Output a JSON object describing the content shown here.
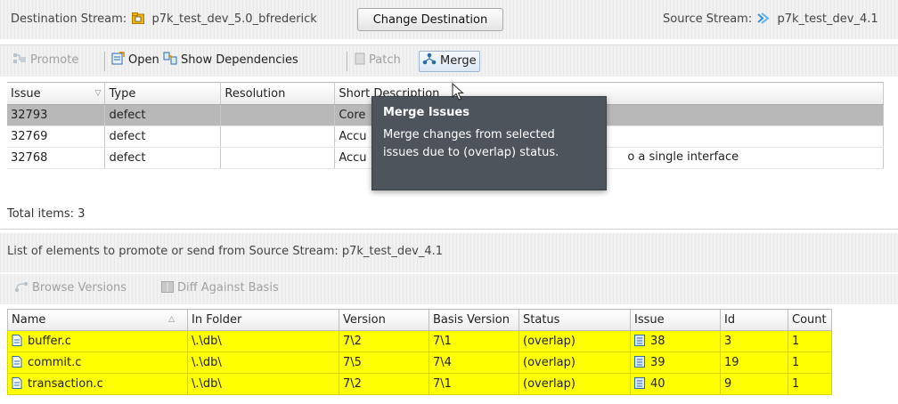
{
  "destination": {
    "label": "Destination Stream:",
    "stream_name": "p7k_test_dev_5.0_bfrederick",
    "change_button": "Change Destination",
    "icon": "dynamic-stream-icon"
  },
  "source": {
    "label": "Source Stream:",
    "stream_name": "p7k_test_dev_4.1",
    "icon": "stream-icon"
  },
  "toolbar": {
    "promote": "Promote",
    "open": "Open",
    "show_dependencies": "Show Dependencies",
    "patch": "Patch",
    "merge": "Merge"
  },
  "issues_table": {
    "columns": [
      "Issue",
      "Type",
      "Resolution",
      "Short Description"
    ],
    "rows": [
      {
        "issue": "32793",
        "type": "defect",
        "resolution": "",
        "description": "Core"
      },
      {
        "issue": "32769",
        "type": "defect",
        "resolution": "",
        "description": "Accu"
      },
      {
        "issue": "32768",
        "type": "defect",
        "resolution": "",
        "description": "Accu",
        "description_tail": "o a single interface"
      }
    ],
    "selected_row": 0
  },
  "total_items": "Total items: 3",
  "list_label": "List of elements to promote or send from Source Stream: p7k_test_dev_4.1",
  "toolbar2": {
    "browse_versions": "Browse Versions",
    "diff_against_basis": "Diff Against Basis"
  },
  "elements_table": {
    "columns": [
      "Name",
      "In Folder",
      "Version",
      "Basis Version",
      "Status",
      "Issue",
      "Id",
      "Count"
    ],
    "rows": [
      {
        "name": "buffer.c",
        "folder": "\\.\\db\\",
        "version": "7\\2",
        "basis": "7\\1",
        "status": "(overlap)",
        "issue": "38",
        "id": "3",
        "count": "1"
      },
      {
        "name": "commit.c",
        "folder": "\\.\\db\\",
        "version": "7\\5",
        "basis": "7\\4",
        "status": "(overlap)",
        "issue": "39",
        "id": "19",
        "count": "1"
      },
      {
        "name": "transaction.c",
        "folder": "\\.\\db\\",
        "version": "7\\2",
        "basis": "7\\1",
        "status": "(overlap)",
        "issue": "40",
        "id": "9",
        "count": "1"
      }
    ],
    "highlight_color": "#ffff00"
  },
  "tooltip": {
    "title": "Merge Issues",
    "body_line1": "Merge changes from selected",
    "body_line2": "issues due to (overlap) status."
  }
}
